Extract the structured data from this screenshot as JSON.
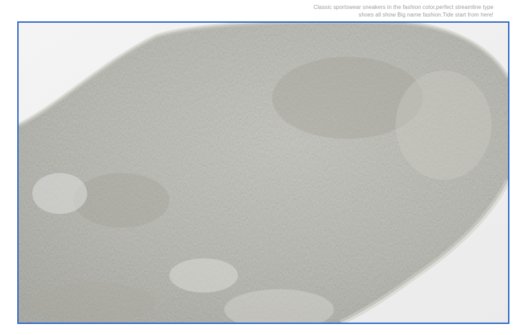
{
  "caption": {
    "line1": "Classic sportswear sneakers in the fashion color,perfect streamline type",
    "line2": "shoes all show Big name fashion.Tide start from here!"
  },
  "photo": {
    "subject": "grey-faux-fur-close-up",
    "colors": {
      "fur_base": "#b8b8b0",
      "fur_light": "#d3d3cc",
      "fur_dark": "#8f8f88",
      "background": "#f3f3f3",
      "frame_border": "#2f66c9"
    }
  }
}
